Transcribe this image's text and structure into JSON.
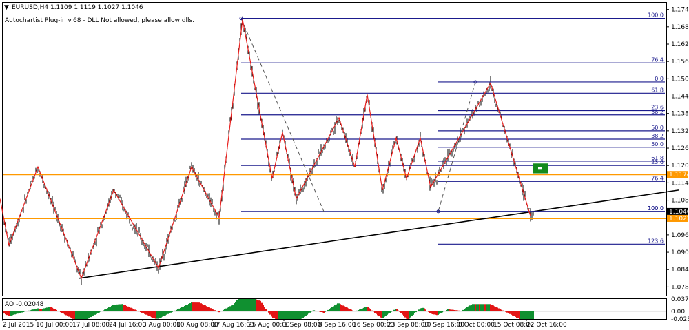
{
  "header": {
    "symbol_line": "EURUSD,H4  1.1109 1.1119 1.1027 1.1046",
    "plugin_note": "Autochartist Plug-in v.68 - DLL Not allowed, please allow dlls."
  },
  "subwindow": {
    "label": "AO -0.02048"
  },
  "colors": {
    "candle": "#000000",
    "zigzag": "#e8201e",
    "fib": "#1a1a8c",
    "support": "#ff9900",
    "trend": "#000000",
    "ao_up": "#109030",
    "ao_down": "#e31515",
    "price_tag": "#ff9900",
    "current_tag": "#000000",
    "pattern_box": "#138a1c"
  },
  "chart_data": {
    "type": "line",
    "symbol": "EURUSD",
    "timeframe": "H4",
    "ohlc": {
      "open": 1.1109,
      "high": 1.1119,
      "low": 1.1027,
      "close": 1.1046
    },
    "ylim": [
      1.0755,
      1.1768
    ],
    "ao_ylim": [
      -0.02325,
      0.03766
    ],
    "y_ticks": [
      "1.1745",
      "1.1685",
      "1.1625",
      "1.1565",
      "1.1505",
      "1.1445",
      "1.1385",
      "1.1325",
      "1.1265",
      "1.1205",
      "1.1145",
      "1.1085",
      "1.1025",
      "1.0965",
      "1.0905",
      "1.0845",
      "1.0785"
    ],
    "ao_ticks": [
      "0.03766",
      "0.00",
      "-0.02325"
    ],
    "x_ticks": [
      "2 Jul 2015",
      "10 Jul 00:00",
      "17 Jul 08:00",
      "24 Jul 16:00",
      "3 Aug 00:00",
      "10 Aug 08:00",
      "17 Aug 16:00",
      "25 Aug 00:00",
      "1 Sep 08:00",
      "8 Sep 16:00",
      "16 Sep 00:00",
      "23 Sep 08:00",
      "30 Sep 16:00",
      "8 Oct 00:00",
      "15 Oct 08:00",
      "22 Oct 16:00"
    ],
    "series": [
      {
        "values": [
          [
            0,
            1.109
          ],
          [
            13,
            1.093
          ],
          [
            55,
            1.12
          ],
          [
            118,
            1.0815
          ],
          [
            165,
            1.112
          ],
          [
            230,
            1.085
          ],
          [
            278,
            1.12
          ],
          [
            318,
            1.1025
          ],
          [
            352,
            1.171
          ],
          [
            395,
            1.116
          ],
          [
            410,
            1.132
          ],
          [
            430,
            1.109
          ],
          [
            492,
            1.137
          ],
          [
            515,
            1.12
          ],
          [
            533,
            1.145
          ],
          [
            555,
            1.112
          ],
          [
            575,
            1.13
          ],
          [
            590,
            1.116
          ],
          [
            610,
            1.13
          ],
          [
            625,
            1.113
          ],
          [
            712,
            1.149
          ],
          [
            770,
            1.103
          ]
        ]
      },
      {
        "values": [
          [
            115,
            1.0815
          ],
          [
            985,
            1.112
          ]
        ]
      }
    ],
    "price_levels": [
      {
        "label": "1.1174",
        "value": 1.1174
      },
      {
        "label": "1.1022",
        "value": 1.1022
      },
      {
        "label": "1.1046",
        "value": 1.1046
      }
    ],
    "fib_levels": [
      {
        "label": "100.0",
        "value": 1.1714
      },
      {
        "label": "76.4",
        "value": 1.156
      },
      {
        "label": "0.0",
        "value": 1.1494
      },
      {
        "label": "61.8",
        "value": 1.1455
      },
      {
        "label": "23.6",
        "value": 1.1395
      },
      {
        "label": "38.2",
        "value": 1.138
      },
      {
        "label": "50.0",
        "value": 1.1325
      },
      {
        "label": "38.2",
        "value": 1.1296
      },
      {
        "label": "50.0",
        "value": 1.1268
      },
      {
        "label": "61.8",
        "value": 1.122
      },
      {
        "label": "23.6",
        "value": 1.1205
      },
      {
        "label": "76.4",
        "value": 1.115
      },
      {
        "label": "100.0",
        "value": 1.1046
      },
      {
        "label": "100.0",
        "value": 1.1046
      },
      {
        "label": "123.6",
        "value": 1.0933
      }
    ]
  }
}
